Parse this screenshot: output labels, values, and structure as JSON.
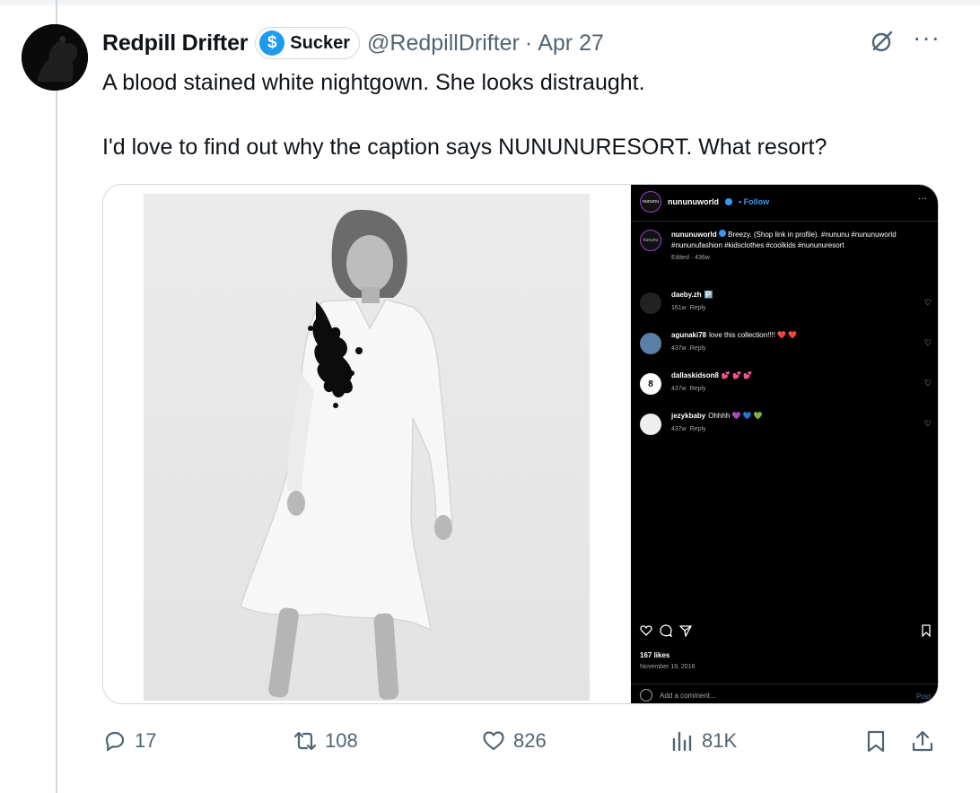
{
  "tweet": {
    "display_name": "Redpill Drifter",
    "badge_label": "Sucker",
    "badge_icon": "dollar-sign-icon",
    "handle": "@RedpillDrifter",
    "separator": "·",
    "date": "Apr 27",
    "text_lines": [
      "A blood stained white nightgown. She looks distraught.",
      "I'd love to find out why the caption says NUNUNURESORT. What resort?"
    ]
  },
  "embedded_post": {
    "avatar_text": "nununu",
    "username": "nununuworld",
    "follow_label": "• Follow",
    "caption_username": "nununuworld",
    "caption": "Breezy. (Shop link in profile). #nununu #nununuworld #nununufashion #kidsclothes #coolkids #nununuresort",
    "caption_meta": "Edited · 436w",
    "comments": [
      {
        "user": "daeby.zh",
        "text": "🅿️",
        "time": "161w",
        "reply": "Reply"
      },
      {
        "user": "agunaki78",
        "text": "love this collection!!!! ❤️ ❤️",
        "time": "437w",
        "reply": "Reply"
      },
      {
        "user": "dallaskidson8",
        "text": "💕 💕 💕",
        "time": "437w",
        "reply": "Reply"
      },
      {
        "user": "jezykbaby",
        "text": "Ohhhh 💜 💙 💚",
        "time": "437w",
        "reply": "Reply"
      }
    ],
    "likes": "167 likes",
    "post_date": "November 19, 2016",
    "add_comment_placeholder": "Add a comment...",
    "post_label": "Post"
  },
  "actions": {
    "replies": "17",
    "reposts": "108",
    "likes": "826",
    "views": "81K"
  },
  "colors": {
    "text_primary": "#0f1419",
    "text_secondary": "#536471",
    "accent": "#1d9bf0",
    "border": "#cfd9de"
  }
}
